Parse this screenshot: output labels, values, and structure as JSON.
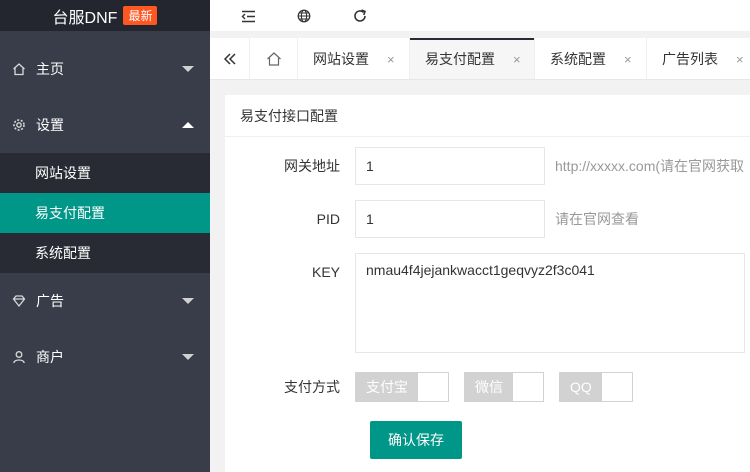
{
  "sidebar": {
    "logo_text": "台服DNF",
    "logo_badge": "最新",
    "menu": [
      {
        "label": "主页",
        "icon": "home-icon"
      },
      {
        "label": "设置",
        "icon": "gear-icon",
        "expanded": true,
        "children": [
          "网站设置",
          "易支付配置",
          "系统配置"
        ],
        "active_child": 1
      },
      {
        "label": "广告",
        "icon": "diamond-icon"
      },
      {
        "label": "商户",
        "icon": "user-icon"
      }
    ]
  },
  "header": {
    "icons": [
      "menu-fold-icon",
      "globe-icon",
      "refresh-icon"
    ]
  },
  "tabs": {
    "items": [
      "网站设置",
      "易支付配置",
      "系统配置",
      "广告列表"
    ],
    "active": 1,
    "close_glyph": "×"
  },
  "form": {
    "title": "易支付接口配置",
    "gateway": {
      "label": "网关地址",
      "value": "1",
      "hint": "http://xxxxx.com(请在官网获取"
    },
    "pid": {
      "label": "PID",
      "value": "1",
      "hint": "请在官网查看"
    },
    "key": {
      "label": "KEY",
      "value": "nmau4f4jejankwacct1geqvyz2f3c041"
    },
    "pay_methods": {
      "label": "支付方式",
      "options": [
        {
          "label": "支付宝",
          "enabled": false
        },
        {
          "label": "微信",
          "enabled": false
        },
        {
          "label": "QQ",
          "enabled": false
        }
      ]
    },
    "submit_label": "确认保存"
  },
  "colors": {
    "accent": "#009688",
    "sidebar": "#393d49",
    "badge": "#ff5722"
  }
}
